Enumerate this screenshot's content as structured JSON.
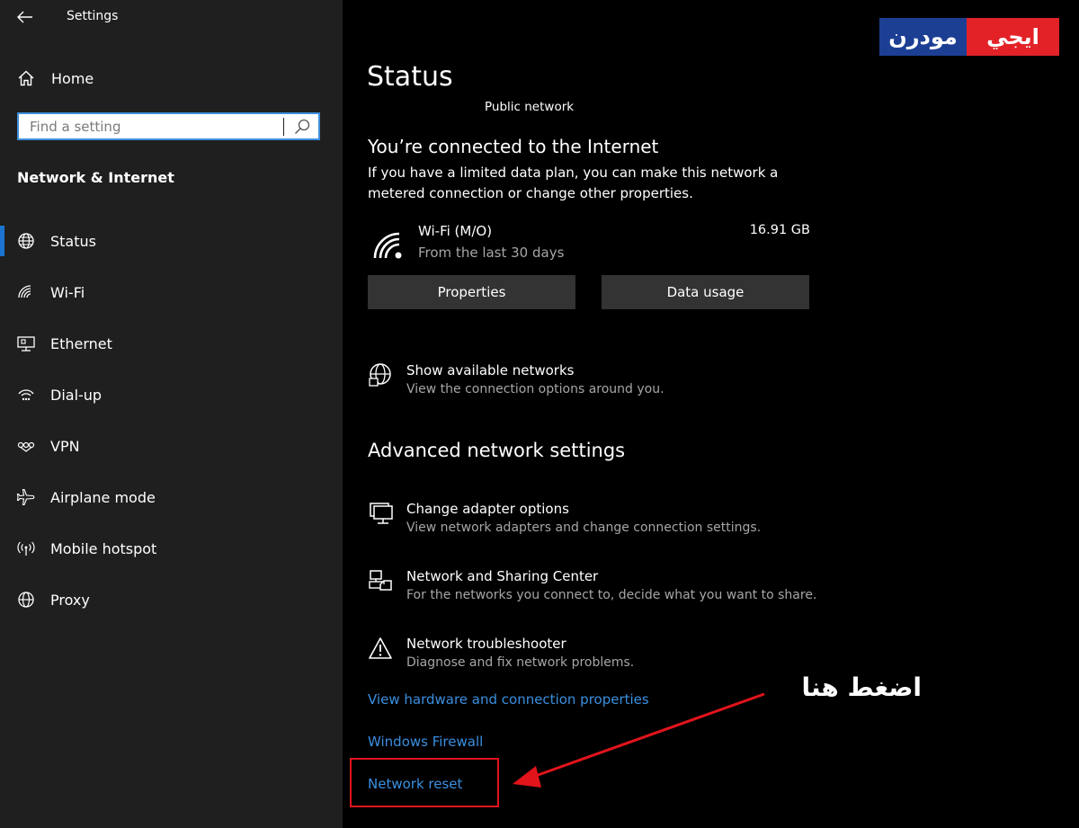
{
  "window": {
    "title": "Settings"
  },
  "sidebar": {
    "home_label": "Home",
    "search": {
      "placeholder": "Find a setting",
      "value": ""
    },
    "section_title": "Network & Internet",
    "items": [
      {
        "label": "Status",
        "icon": "globe-icon",
        "active": true
      },
      {
        "label": "Wi-Fi",
        "icon": "wifi-icon"
      },
      {
        "label": "Ethernet",
        "icon": "ethernet-icon"
      },
      {
        "label": "Dial-up",
        "icon": "dial-up-icon"
      },
      {
        "label": "VPN",
        "icon": "vpn-icon"
      },
      {
        "label": "Airplane mode",
        "icon": "airplane-icon"
      },
      {
        "label": "Mobile hotspot",
        "icon": "hotspot-icon"
      },
      {
        "label": "Proxy",
        "icon": "globe-icon"
      }
    ]
  },
  "logo": {
    "part1": "ايجي",
    "part2": "مودرن"
  },
  "main": {
    "title": "Status",
    "network_type": "Public network",
    "connected_heading": "You’re connected to the Internet",
    "connected_desc": "If you have a limited data plan, you can make this network a metered connection or change other properties.",
    "connection": {
      "name": "Wi-Fi (M/O)",
      "subtitle": "From the last 30 days",
      "usage": "16.91 GB"
    },
    "buttons": {
      "properties": "Properties",
      "data_usage": "Data usage"
    },
    "show_networks": {
      "title": "Show available networks",
      "subtitle": "View the connection options around you."
    },
    "advanced_heading": "Advanced network settings",
    "advanced_items": [
      {
        "title": "Change adapter options",
        "subtitle": "View network adapters and change connection settings.",
        "icon": "adapter-icon"
      },
      {
        "title": "Network and Sharing Center",
        "subtitle": "For the networks you connect to, decide what you want to share.",
        "icon": "sharing-center-icon"
      },
      {
        "title": "Network troubleshooter",
        "subtitle": "Diagnose and fix network problems.",
        "icon": "warning-icon"
      }
    ],
    "links": {
      "hardware": "View hardware and connection properties",
      "firewall": "Windows Firewall",
      "reset": "Network reset"
    }
  },
  "annotation": {
    "text": "اضغط هنا",
    "color": "#e1141b"
  },
  "colors": {
    "sidebar_bg": "#1f1f1f",
    "main_bg": "#000000",
    "accent": "#1b74d1",
    "link": "#3a8fe0",
    "button_bg": "#333333"
  }
}
